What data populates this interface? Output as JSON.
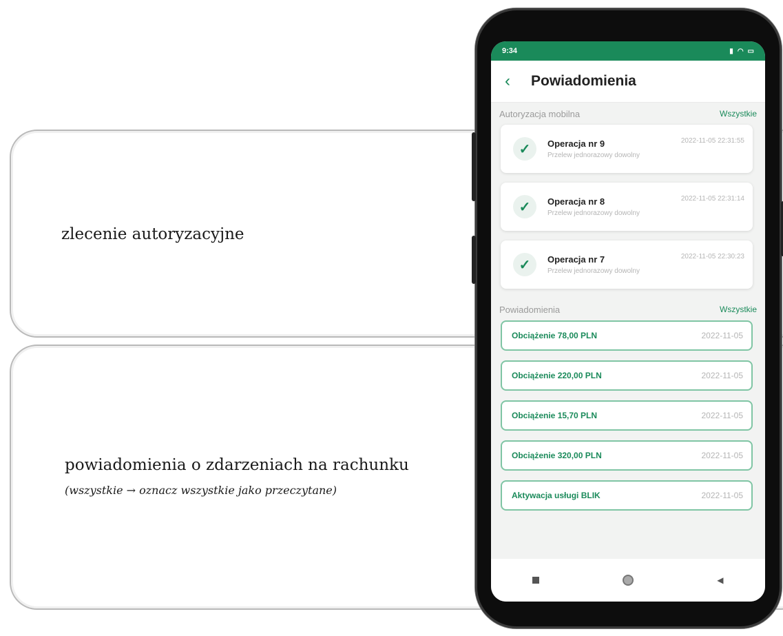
{
  "annotations": {
    "auth_label": "zlecenie autoryzacyjne",
    "notif_label": "powiadomienia o zdarzeniach na rachunku",
    "notif_sub": "(wszystkie → oznacz wszystkie jako przeczytane)"
  },
  "status_bar": {
    "time": "9:34",
    "icons": [
      "signal-icon",
      "wifi-icon",
      "battery-icon"
    ]
  },
  "header": {
    "title": "Powiadomienia",
    "back_icon": "chevron-left-icon"
  },
  "auth_section": {
    "title": "Autoryzacja mobilna",
    "link": "Wszystkie",
    "items": [
      {
        "title": "Operacja nr 9",
        "subtitle": "Przelew jednorazowy dowolny",
        "date": "2022-11-05 22:31:55"
      },
      {
        "title": "Operacja nr 8",
        "subtitle": "Przelew jednorazowy dowolny",
        "date": "2022-11-05 22:31:14"
      },
      {
        "title": "Operacja nr 7",
        "subtitle": "Przelew jednorazowy dowolny",
        "date": "2022-11-05 22:30:23"
      }
    ]
  },
  "notif_section": {
    "title": "Powiadomienia",
    "link": "Wszystkie",
    "items": [
      {
        "title": "Obciążenie 78,00 PLN",
        "date": "2022-11-05"
      },
      {
        "title": "Obciążenie 220,00 PLN",
        "date": "2022-11-05"
      },
      {
        "title": "Obciążenie 15,70 PLN",
        "date": "2022-11-05"
      },
      {
        "title": "Obciążenie 320,00 PLN",
        "date": "2022-11-05"
      },
      {
        "title": "Aktywacja usługi BLIK",
        "date": "2022-11-05"
      }
    ]
  },
  "colors": {
    "brand": "#1a8a5a",
    "card_border": "#7fc5a4"
  }
}
